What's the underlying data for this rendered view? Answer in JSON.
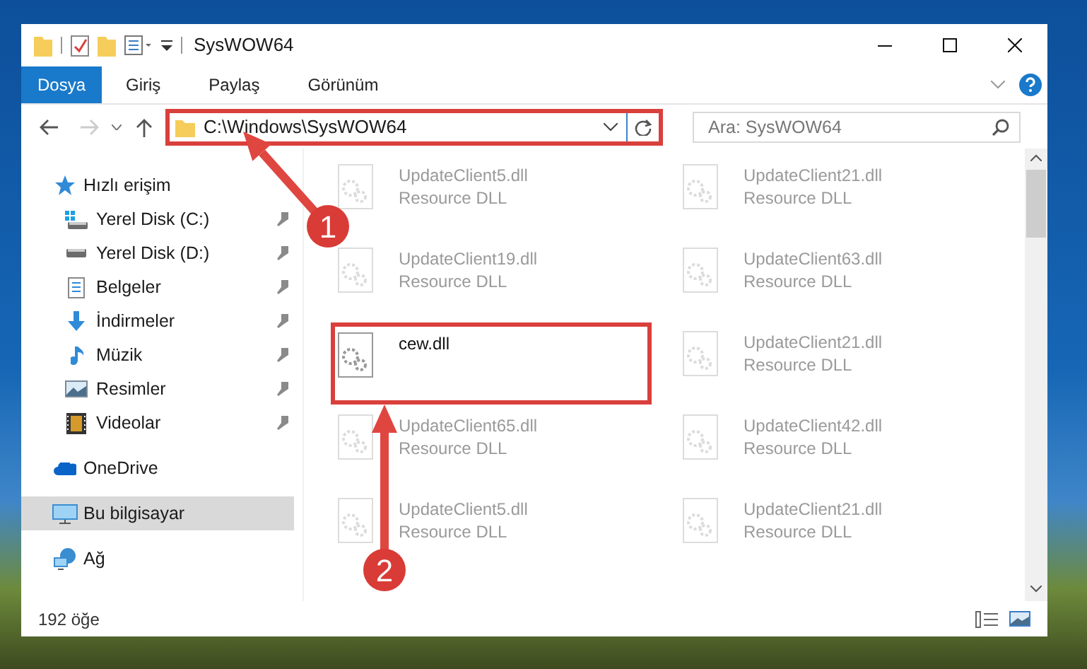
{
  "window": {
    "title": "SysWOW64"
  },
  "ribbon_tabs": [
    {
      "label": "Dosya",
      "kind": "file",
      "selected": false
    },
    {
      "label": "Giriş",
      "kind": "tab",
      "selected": false
    },
    {
      "label": "Paylaş",
      "kind": "tab",
      "selected": false
    },
    {
      "label": "Görünüm",
      "kind": "tab",
      "selected": false
    }
  ],
  "address": {
    "path": "C:\\Windows\\SysWOW64"
  },
  "search": {
    "placeholder": "Ara: SysWOW64"
  },
  "sidebar": {
    "items": [
      {
        "label": "Hızlı erişim",
        "selected": false,
        "children": [
          {
            "label": "Yerel Disk (C:)",
            "pinned": true,
            "selected": false
          },
          {
            "label": "Yerel Disk (D:)",
            "pinned": true,
            "selected": false
          },
          {
            "label": "Belgeler",
            "pinned": true,
            "selected": false
          },
          {
            "label": "İndirmeler",
            "pinned": true,
            "selected": false
          },
          {
            "label": "Müzik",
            "pinned": true,
            "selected": false
          },
          {
            "label": "Resimler",
            "pinned": true,
            "selected": false
          },
          {
            "label": "Videolar",
            "pinned": true,
            "selected": false
          }
        ]
      },
      {
        "label": "OneDrive",
        "selected": false
      },
      {
        "label": "Bu bilgisayar",
        "selected": true
      },
      {
        "label": "Ağ",
        "selected": false
      }
    ]
  },
  "files": [
    {
      "name": "UpdateClient5.dll",
      "type": "Resource DLL",
      "faded": true
    },
    {
      "name": "UpdateClient21.dll",
      "type": "Resource DLL",
      "faded": true
    },
    {
      "name": "UpdateClient19.dll",
      "type": "Resource DLL",
      "faded": true
    },
    {
      "name": "UpdateClient63.dll",
      "type": "Resource DLL",
      "faded": true
    },
    {
      "name": "cew.dll",
      "faded": false
    },
    {
      "name": "UpdateClient21.dll",
      "type": "Resource DLL",
      "faded": true
    },
    {
      "name": "UpdateClient65.dll",
      "type": "Resource DLL",
      "faded": true
    },
    {
      "name": "UpdateClient42.dll",
      "type": "Resource DLL",
      "faded": true
    },
    {
      "name": "UpdateClient5.dll",
      "type": "Resource DLL",
      "faded": true
    },
    {
      "name": "UpdateClient21.dll",
      "type": "Resource DLL",
      "faded": true
    }
  ],
  "status_bar": {
    "count": "192 öğe"
  },
  "annotations": [
    {
      "label": "1"
    },
    {
      "label": "2"
    }
  ]
}
